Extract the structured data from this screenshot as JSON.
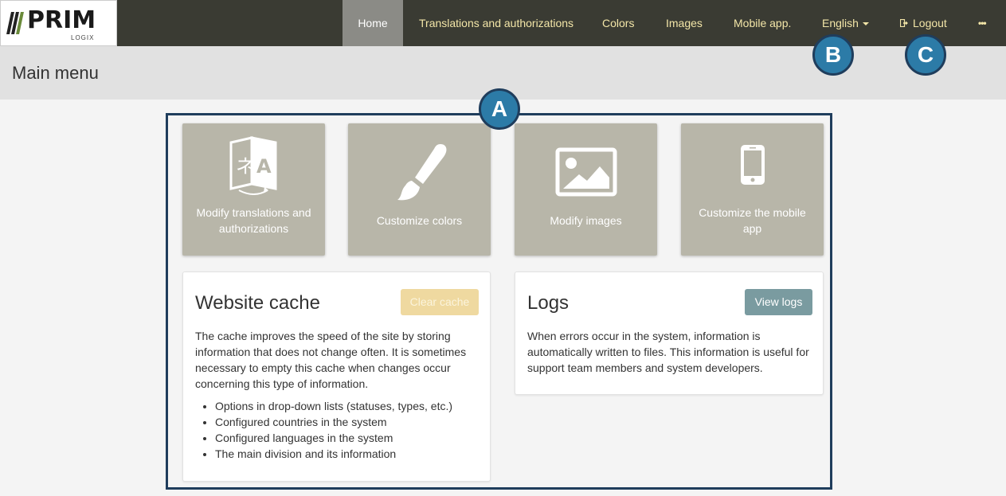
{
  "logo": {
    "main": "PRIM",
    "sub": "LOGIX"
  },
  "nav": {
    "items": [
      {
        "label": "Home"
      },
      {
        "label": "Translations and authorizations"
      },
      {
        "label": "Colors"
      },
      {
        "label": "Images"
      },
      {
        "label": "Mobile app."
      }
    ],
    "language": "English",
    "logout": "Logout",
    "more": "•••"
  },
  "page": {
    "title": "Main menu"
  },
  "badges": {
    "a": "A",
    "b": "B",
    "c": "C"
  },
  "tiles": [
    {
      "label": "Modify translations and authorizations",
      "icon": "translate-icon"
    },
    {
      "label": "Customize colors",
      "icon": "paintbrush-icon"
    },
    {
      "label": "Modify images",
      "icon": "image-icon"
    },
    {
      "label": "Customize the mobile app",
      "icon": "mobile-phone-icon"
    }
  ],
  "cache_card": {
    "title": "Website cache",
    "button": "Clear cache",
    "text": "The cache improves the speed of the site by storing information that does not change often. It is sometimes necessary to empty this cache when changes occur concerning this type of information.",
    "list": [
      "Options in drop-down lists (statuses, types, etc.)",
      "Configured countries in the system",
      "Configured languages in the system",
      "The main division and its information"
    ]
  },
  "logs_card": {
    "title": "Logs",
    "button": "View logs",
    "text": "When errors occur in the system, information is automatically written to files. This information is useful for support team members and system developers."
  },
  "colors": {
    "navbar": "#3a3b33",
    "nav_text": "#f3e6a8",
    "tile": "#b8b6a9",
    "callout": "#1f3d5c",
    "badge": "#2c7ba7"
  }
}
